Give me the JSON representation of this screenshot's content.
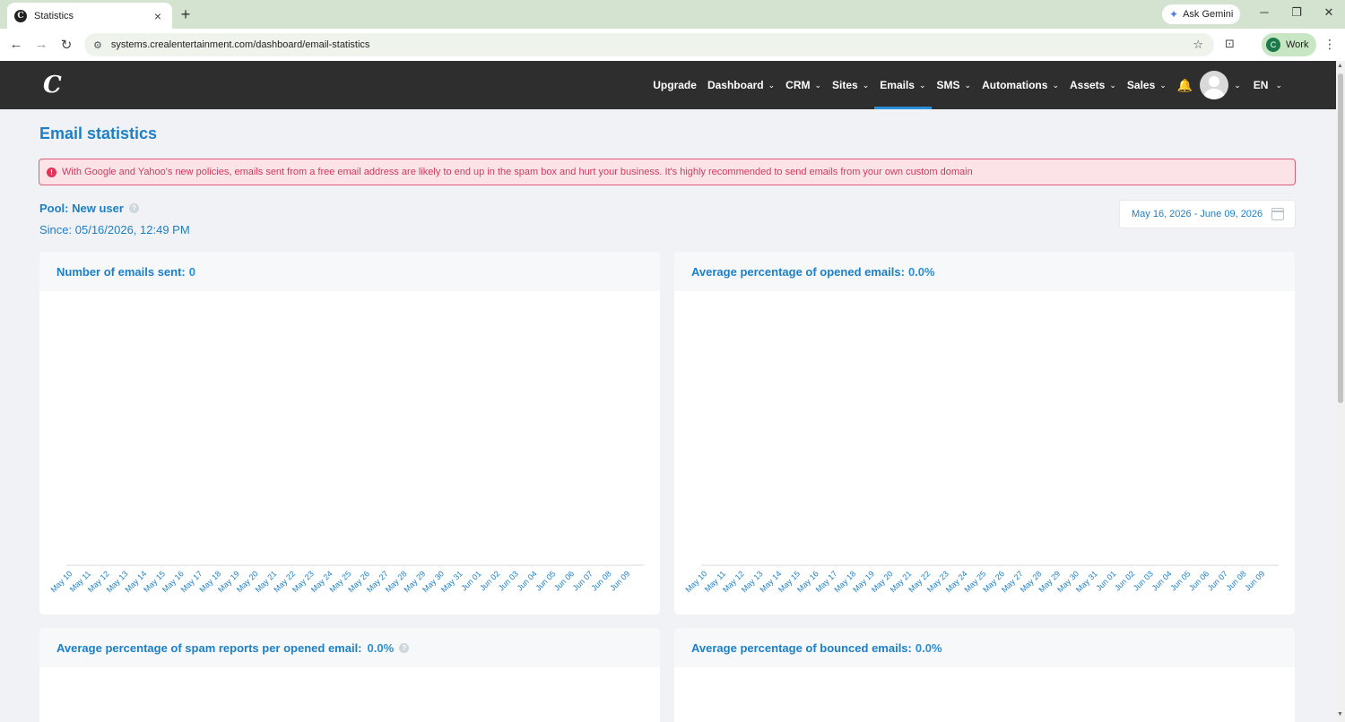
{
  "browser": {
    "tab_title": "Statistics",
    "tab_favicon_letter": "C",
    "url": "systems.crealentertainment.com/dashboard/email-statistics",
    "gemini_label": "Ask Gemini",
    "profile_letter": "C",
    "profile_label": "Work"
  },
  "header": {
    "logo": "C",
    "nav": [
      {
        "label": "Upgrade",
        "has_menu": false
      },
      {
        "label": "Dashboard",
        "has_menu": true
      },
      {
        "label": "CRM",
        "has_menu": true
      },
      {
        "label": "Sites",
        "has_menu": true
      },
      {
        "label": "Emails",
        "has_menu": true,
        "active": true
      },
      {
        "label": "SMS",
        "has_menu": true
      },
      {
        "label": "Automations",
        "has_menu": true
      },
      {
        "label": "Assets",
        "has_menu": true
      },
      {
        "label": "Sales",
        "has_menu": true
      }
    ],
    "language": "EN"
  },
  "main": {
    "title": "Email statistics",
    "alert": "With Google and Yahoo's new policies, emails sent from a free email address are likely to end up in the spam box and hurt your business. It's highly recommended to send emails from your own custom domain",
    "pool": "Pool: New user",
    "since": "Since: 05/16/2026, 12:49 PM",
    "date_range": "May 16, 2026 - June 09, 2026"
  },
  "cards": [
    {
      "label": "Number of emails sent:",
      "value": "0"
    },
    {
      "label": "Average percentage of opened emails:",
      "value": "0.0%"
    },
    {
      "label": "Average percentage of spam reports per opened email:",
      "value": "0.0%"
    },
    {
      "label": "Average percentage of bounced emails:",
      "value": "0.0%"
    }
  ],
  "colors": {
    "accent": "#1c7fc7",
    "header_bg": "#2e2e2e",
    "alert_text": "#d13a5c"
  },
  "chart_data": [
    {
      "type": "line",
      "x": [
        "May 10",
        "May 11",
        "May 12",
        "May 13",
        "May 14",
        "May 15",
        "May 16",
        "May 17",
        "May 18",
        "May 19",
        "May 20",
        "May 21",
        "May 22",
        "May 23",
        "May 24",
        "May 25",
        "May 26",
        "May 27",
        "May 28",
        "May 29",
        "May 30",
        "May 31",
        "Jun 01",
        "Jun 02",
        "Jun 03",
        "Jun 04",
        "Jun 05",
        "Jun 06",
        "Jun 07",
        "Jun 08",
        "Jun 09"
      ],
      "series": []
    },
    {
      "type": "line",
      "x": [
        "May 10",
        "May 11",
        "May 12",
        "May 13",
        "May 14",
        "May 15",
        "May 16",
        "May 17",
        "May 18",
        "May 19",
        "May 20",
        "May 21",
        "May 22",
        "May 23",
        "May 24",
        "May 25",
        "May 26",
        "May 27",
        "May 28",
        "May 29",
        "May 30",
        "May 31",
        "Jun 01",
        "Jun 02",
        "Jun 03",
        "Jun 04",
        "Jun 05",
        "Jun 06",
        "Jun 07",
        "Jun 08",
        "Jun 09"
      ],
      "series": []
    }
  ]
}
